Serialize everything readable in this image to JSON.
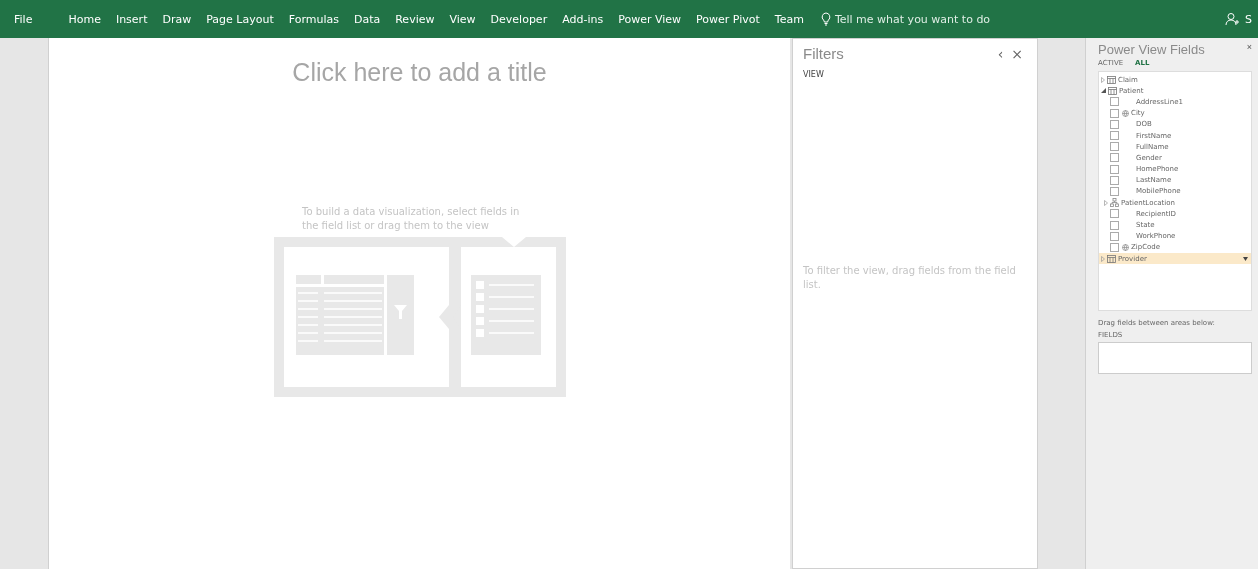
{
  "ribbon": {
    "tabs": [
      {
        "label": "File",
        "selected": false
      },
      {
        "label": "Home",
        "selected": false
      },
      {
        "label": "Insert",
        "selected": false
      },
      {
        "label": "Draw",
        "selected": false
      },
      {
        "label": "Page Layout",
        "selected": false
      },
      {
        "label": "Formulas",
        "selected": false
      },
      {
        "label": "Data",
        "selected": false
      },
      {
        "label": "Review",
        "selected": false
      },
      {
        "label": "View",
        "selected": false
      },
      {
        "label": "Developer",
        "selected": false
      },
      {
        "label": "Add-ins",
        "selected": false
      },
      {
        "label": "Power View",
        "selected": false
      },
      {
        "label": "Power Pivot",
        "selected": false
      },
      {
        "label": "Team",
        "selected": false
      }
    ],
    "tell_me": {
      "placeholder": "Tell me what you want to do"
    },
    "share": "S"
  },
  "canvas": {
    "title_placeholder": "Click here to add a title",
    "hint": "To build a data visualization, select fields in the field list or drag them to the view"
  },
  "filters": {
    "title": "Filters",
    "collapse": "‹",
    "close": "×",
    "section": "VIEW",
    "hint": "To filter the view, drag fields from the field list."
  },
  "fields": {
    "title": "Power View Fields",
    "close": "×",
    "tabs": [
      {
        "label": "ACTIVE",
        "selected": false
      },
      {
        "label": "ALL",
        "selected": true
      }
    ],
    "tree": [
      {
        "kind": "table",
        "label": "Claim",
        "expanded": false,
        "highlighted": false
      },
      {
        "kind": "table",
        "label": "Patient",
        "expanded": true,
        "highlighted": false,
        "children": [
          {
            "kind": "field",
            "label": "AddressLine1",
            "checked": false,
            "geo": false
          },
          {
            "kind": "field",
            "label": "City",
            "checked": false,
            "geo": true
          },
          {
            "kind": "field",
            "label": "DOB",
            "checked": false,
            "geo": false
          },
          {
            "kind": "field",
            "label": "FirstName",
            "checked": false,
            "geo": false
          },
          {
            "kind": "field",
            "label": "FullName",
            "checked": false,
            "geo": false
          },
          {
            "kind": "field",
            "label": "Gender",
            "checked": false,
            "geo": false
          },
          {
            "kind": "field",
            "label": "HomePhone",
            "checked": false,
            "geo": false
          },
          {
            "kind": "field",
            "label": "LastName",
            "checked": false,
            "geo": false
          },
          {
            "kind": "field",
            "label": "MobilePhone",
            "checked": false,
            "geo": false
          },
          {
            "kind": "hierarchy",
            "label": "PatientLocation",
            "expanded": false
          },
          {
            "kind": "field",
            "label": "RecipientID",
            "checked": false,
            "geo": false
          },
          {
            "kind": "field",
            "label": "State",
            "checked": false,
            "geo": false
          },
          {
            "kind": "field",
            "label": "WorkPhone",
            "checked": false,
            "geo": false
          },
          {
            "kind": "field",
            "label": "ZipCode",
            "checked": false,
            "geo": true
          }
        ]
      },
      {
        "kind": "table",
        "label": "Provider",
        "expanded": false,
        "highlighted": true
      }
    ],
    "areas_hint": "Drag fields between areas below:",
    "area_label": "FIELDS"
  }
}
